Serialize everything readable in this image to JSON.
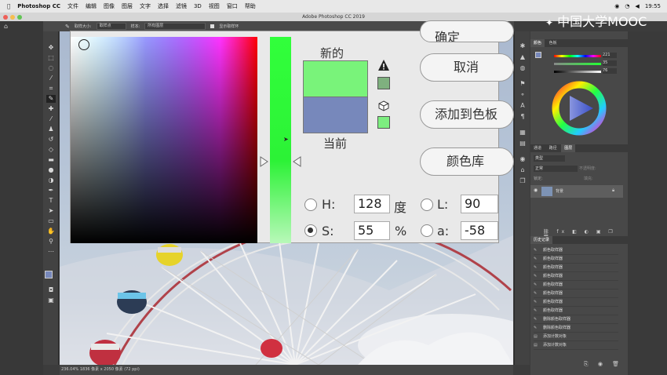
{
  "menubar": {
    "app": "Photoshop CC",
    "items": [
      "文件",
      "编辑",
      "图像",
      "图层",
      "文字",
      "选择",
      "滤镜",
      "3D",
      "视图",
      "窗口",
      "帮助"
    ],
    "time": "19:55"
  },
  "window": {
    "title": "Adobe Photoshop CC 2019"
  },
  "options": {
    "sample_size_label": "取样大小:",
    "sample_size_value": "取样点",
    "sample_label": "样本:",
    "sample_value": "所有图层",
    "show_ring": "显示取样环"
  },
  "status": {
    "text": "236.04%    1836 像素 x 2050 像素 (72 ppi)"
  },
  "picker": {
    "new_label": "新的",
    "current_label": "当前",
    "new_color": "#79f37a",
    "current_color": "#7788bb",
    "buttons": {
      "ok": "确定",
      "cancel": "取消",
      "add_to_swatches": "添加到色板",
      "color_libraries": "颜色库"
    },
    "fields": {
      "h_label": "H:",
      "h_value": "128",
      "h_unit": "度",
      "s_label": "S:",
      "s_value": "55",
      "s_unit": "%",
      "l_label": "L:",
      "l_value": "90",
      "a_label": "a:",
      "a_value": "-58"
    }
  },
  "color_panel": {
    "tabs": [
      "颜色",
      "色板"
    ],
    "values": [
      "221",
      "35",
      "76"
    ]
  },
  "layers_panel": {
    "tabs": [
      "通道",
      "路径",
      "图层"
    ],
    "kind": "类型",
    "mode": "正常",
    "opacity_label": "不透明度:",
    "fill_label": "填充:",
    "lock_label": "锁定:",
    "layer_name": "背景"
  },
  "history_panel": {
    "tab": "历史记录",
    "items": [
      "颜色取样器",
      "颜色取样器",
      "颜色取样器",
      "颜色取样器",
      "颜色取样器",
      "颜色取样器",
      "颜色取样器",
      "颜色取样器",
      "删除颜色取样器",
      "删除颜色取样器",
      "添加计数对象",
      "添加计数对象"
    ]
  },
  "watermark": {
    "text": "中国大学MOOC"
  },
  "colors": {
    "accent": "#79f37a",
    "current": "#7788bb"
  }
}
